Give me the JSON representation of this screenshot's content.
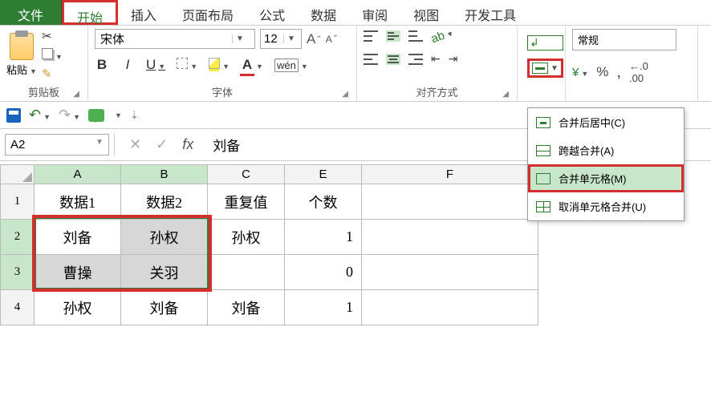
{
  "tabs": {
    "file": "文件",
    "home": "开始",
    "insert": "插入",
    "layout": "页面布局",
    "formula": "公式",
    "data": "数据",
    "review": "审阅",
    "view": "视图",
    "dev": "开发工具"
  },
  "clipboard": {
    "paste": "粘贴",
    "group": "剪贴板"
  },
  "font": {
    "name": "宋体",
    "size": "12",
    "bold": "B",
    "italic": "I",
    "underline": "U",
    "fontcolor_letter": "A",
    "wen": "wén",
    "group": "字体"
  },
  "align": {
    "group": "对齐方式"
  },
  "number": {
    "format": "常规",
    "percent": "%",
    "comma": ",",
    "decmore": ".00"
  },
  "merge_menu": {
    "center": "合并后居中(C)",
    "across": "跨越合并(A)",
    "merge": "合并单元格(M)",
    "unmerge": "取消单元格合并(U)"
  },
  "namebox": "A2",
  "formula_value": "刘备",
  "cols": {
    "A": "A",
    "B": "B",
    "C": "C",
    "E": "E",
    "F": "F"
  },
  "rows": {
    "r1": "1",
    "r2": "2",
    "r3": "3",
    "r4": "4"
  },
  "cells": {
    "A1": "数据1",
    "B1": "数据2",
    "C1": "重复值",
    "E1": "个数",
    "A2": "刘备",
    "B2": "孙权",
    "C2": "孙权",
    "E2": "1",
    "A3": "曹操",
    "B3": "关羽",
    "C3": "",
    "E3": "0",
    "A4": "孙权",
    "B4": "刘备",
    "C4": "刘备",
    "E4": "1"
  }
}
